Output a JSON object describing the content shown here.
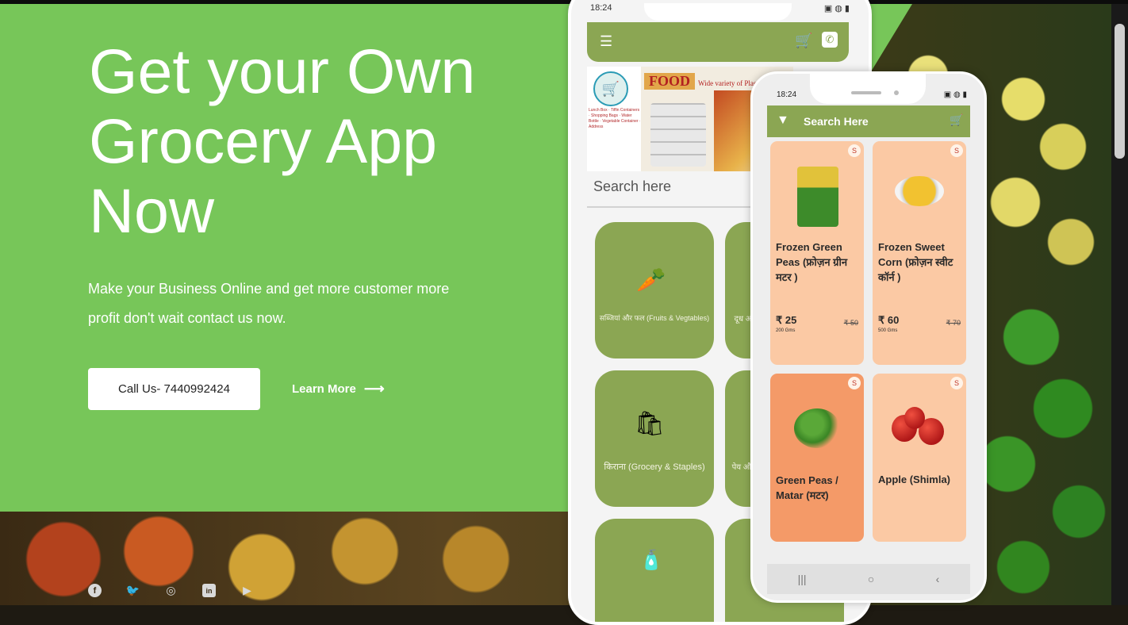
{
  "hero": {
    "headline": "Get your Own Grocery App Now",
    "subtext": "Make your Business Online and get more customer more profit don't wait contact us now.",
    "call_button": "Call Us- 7440992424",
    "learn_more": "Learn More",
    "arrow": "⟶"
  },
  "social": [
    {
      "name": "facebook-icon",
      "glyph": "f"
    },
    {
      "name": "twitter-icon",
      "glyph": "🐦"
    },
    {
      "name": "instagram-icon",
      "glyph": "◎"
    },
    {
      "name": "linkedin-icon",
      "glyph": "in"
    },
    {
      "name": "youtube-icon",
      "glyph": "▶"
    }
  ],
  "phone_back": {
    "time": "18:24",
    "status_right": "▣ ◍ ▮",
    "menu_glyph": "☰",
    "cart_glyph": "🛒",
    "phone_glyph": "✆",
    "banner_food": "FOOD",
    "banner_sub": "Wide variety of Plastic",
    "banner_tiny": "Lunch Box · Tiffin Containers · Shopping Bags · Water Bottle · Vegetable Container · Address",
    "search_placeholder": "Search here",
    "categories": [
      {
        "label": "सब्जियां और फल (Fruits & Vegtables)",
        "glyph": "🥕"
      },
      {
        "label": "दूध और...",
        "glyph": ""
      },
      {
        "label": "किराना (Grocery & Staples)",
        "glyph": "🛍"
      },
      {
        "label": "पेय औ...",
        "glyph": ""
      },
      {
        "label": "",
        "glyph": "🧴"
      }
    ]
  },
  "phone_front": {
    "time": "18:24",
    "status_right": "▣ ◍ ▮",
    "filter_glyph": "▼",
    "title": "Search Here",
    "cart_glyph": "🛒",
    "badge": "S",
    "products": [
      {
        "name": "Frozen Green Peas (फ्रोज़न ग्रीन मटर )",
        "price": "₹ 25",
        "qty": "200 Gms",
        "mrp": "₹ 50"
      },
      {
        "name": "Frozen Sweet Corn (फ्रोज़न स्वीट कॉर्न )",
        "price": "₹ 60",
        "qty": "500 Gms",
        "mrp": "₹ 70"
      },
      {
        "name": "Green Peas / Matar (मटर)"
      },
      {
        "name": "Apple (Shimla)"
      }
    ],
    "nav": [
      "|||",
      "○",
      "‹"
    ]
  },
  "colors": {
    "green": "#77c659",
    "olive": "#8ba653",
    "card_light": "#fbc9a4",
    "card_dark": "#f49a68"
  }
}
